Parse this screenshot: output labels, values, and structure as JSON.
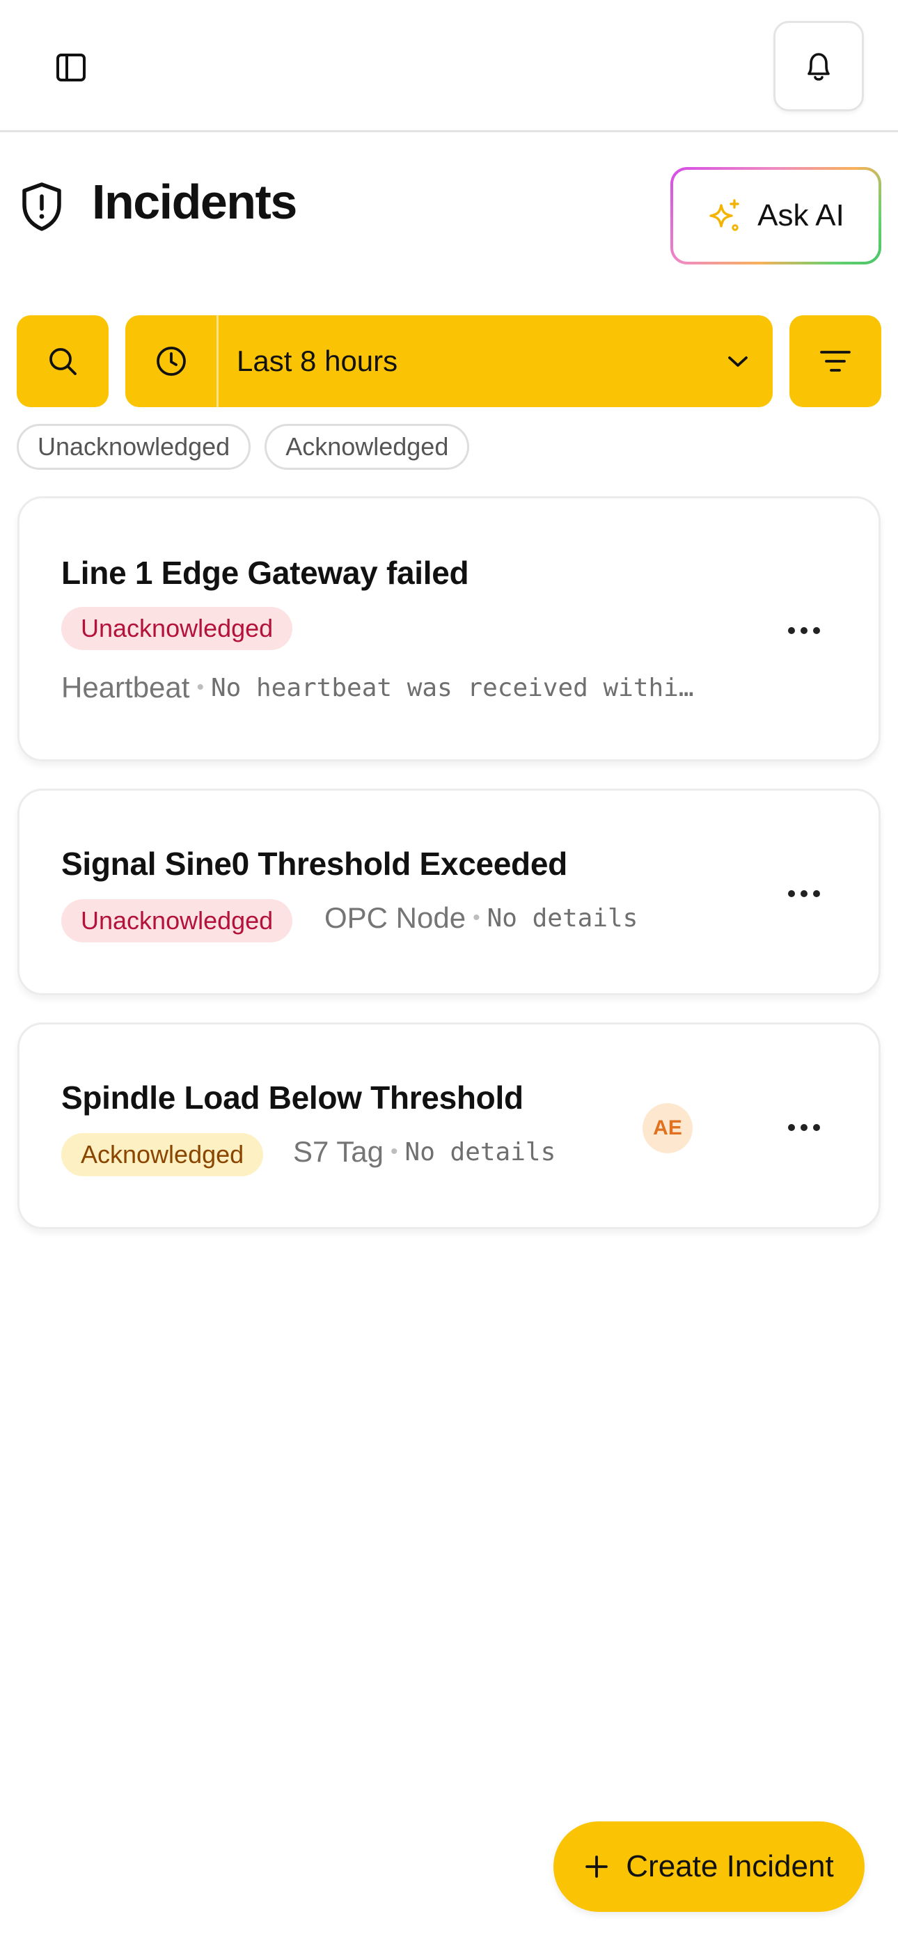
{
  "header": {
    "sidebar_toggle_icon": "sidebar-panel-icon",
    "notifications_icon": "bell-icon"
  },
  "page": {
    "title": "Incidents",
    "title_icon": "shield-icon",
    "ask_ai_label": "Ask AI",
    "ask_ai_icon": "sparkles-icon"
  },
  "controls": {
    "search_icon": "search-icon",
    "time_range_icon": "clock-icon",
    "time_range_value": "Last 8 hours",
    "filter_icon": "filter-icon"
  },
  "status_filters": [
    "Unacknowledged",
    "Acknowledged"
  ],
  "incidents": [
    {
      "title": "Line 1 Edge Gateway failed",
      "status": "Unacknowledged",
      "source": "Heartbeat",
      "details": "No heartbeat was received withi…"
    },
    {
      "title": "Signal Sine0 Threshold Exceeded",
      "status": "Unacknowledged",
      "source": "OPC Node",
      "details": "No details"
    },
    {
      "title": "Spindle Load Below Threshold",
      "status": "Acknowledged",
      "source": "S7 Tag",
      "details": "No details",
      "assignee_initials": "AE"
    }
  ],
  "fab": {
    "label": "Create Incident",
    "icon": "plus-icon"
  },
  "colors": {
    "accent": "#fac404",
    "unacknowledged_bg": "#fde2e4",
    "unacknowledged_text": "#b3123a",
    "acknowledged_bg": "#fdf0c2",
    "acknowledged_text": "#8a4500"
  }
}
